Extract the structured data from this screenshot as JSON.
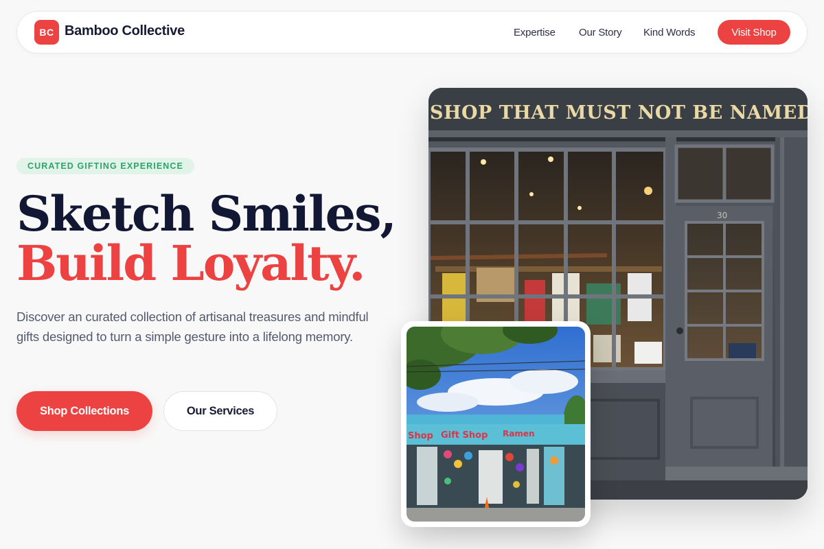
{
  "nav": {
    "logo_initials": "BC",
    "brand_name": "Bamboo Collective",
    "links": [
      "Expertise",
      "Our Story",
      "Kind Words"
    ],
    "cta_label": "Visit Shop"
  },
  "hero": {
    "tag": "CURATED GIFTING EXPERIENCE",
    "headline_line1": "Sketch Smiles,",
    "headline_line2": "Build Loyalty.",
    "description": "Discover an curated collection of artisanal treasures and mindful gifts designed to turn a simple gesture into a lifelong memory.",
    "primary_button": "Shop Collections",
    "secondary_button": "Our Services"
  },
  "images": {
    "main_sign_text": "SHOP THAT MUST NOT BE NAMED",
    "main_door_number": "30",
    "small_sign_left": "Shop",
    "small_sign_center": "Gift Shop",
    "small_sign_right": "Ramen"
  },
  "colors": {
    "accent": "#ec4242",
    "navy": "#121833",
    "tag_green": "#2ca36a",
    "tag_bg": "#e2f3ea",
    "page_bg": "#f8f8f8"
  }
}
